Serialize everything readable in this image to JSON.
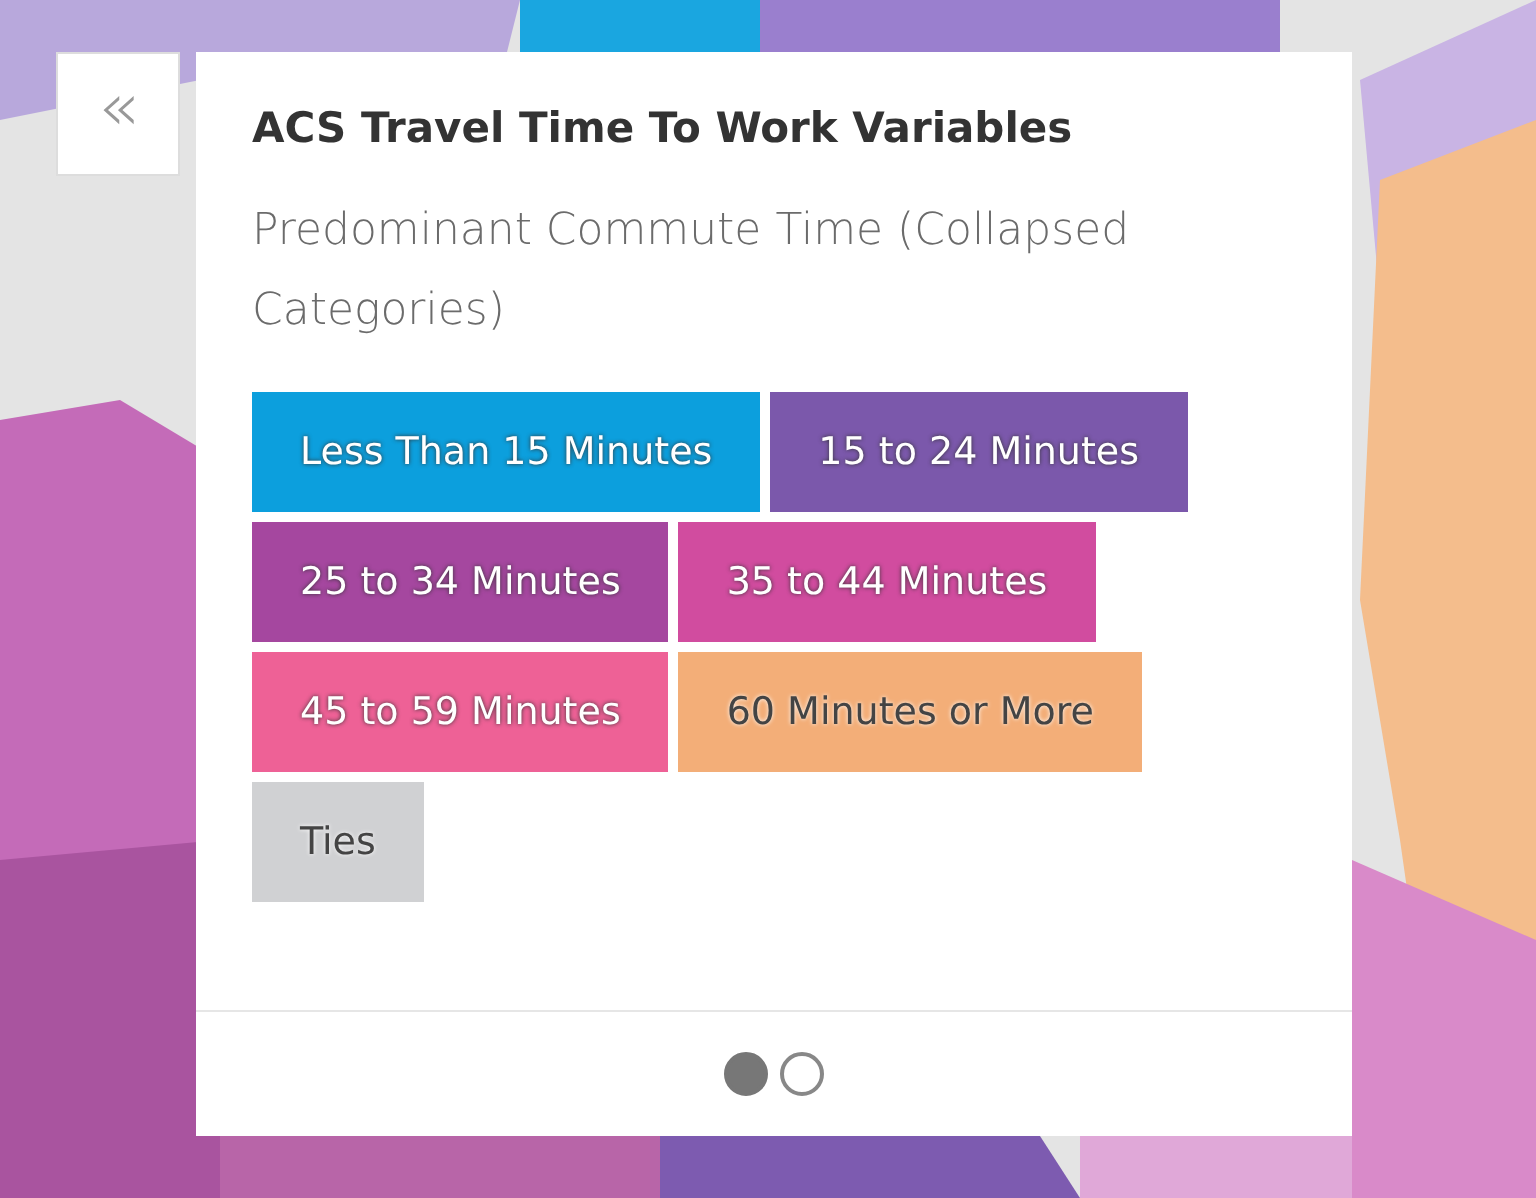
{
  "collapse_button": {
    "label": "«"
  },
  "panel": {
    "title": "ACS Travel Time To Work Variables",
    "subtitle": "Predominant Commute Time (Collapsed Categories)",
    "legend": [
      {
        "label": "Less Than 15 Minutes",
        "color": "#0c9fdd"
      },
      {
        "label": "15 to 24 Minutes",
        "color": "#7b58ab"
      },
      {
        "label": "25 to 34 Minutes",
        "color": "#a5479f"
      },
      {
        "label": "35 to 44 Minutes",
        "color": "#d14c9f"
      },
      {
        "label": "45 to 59 Minutes",
        "color": "#ee6196"
      },
      {
        "label": "60 Minutes or More",
        "color": "#f3ae78"
      },
      {
        "label": "Ties",
        "color": "#d0d1d3"
      }
    ],
    "pages": [
      {
        "selected": true
      },
      {
        "selected": false
      }
    ]
  }
}
